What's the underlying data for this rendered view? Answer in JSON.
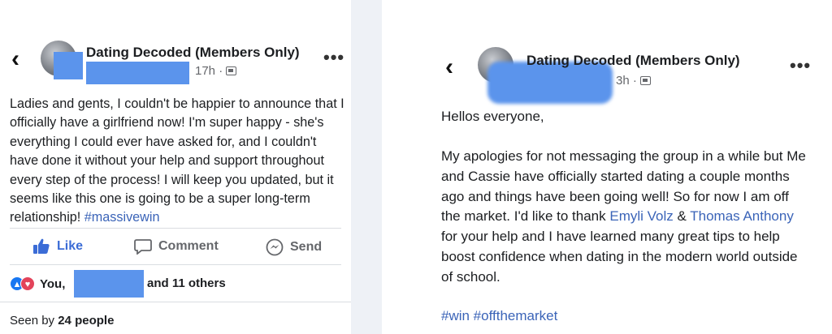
{
  "left_post": {
    "back_icon": "chevron-left-icon",
    "group_name": "Dating Decoded (Members Only)",
    "time": "17h ·",
    "privacy_icon": "members-icon",
    "more_icon": "more-horizontal-icon",
    "more_label": "•••",
    "body": "Ladies and gents, I couldn't be happier to announce that I officially have a girlfriend now! I'm super happy - she's everything I could ever have asked for, and I couldn't have done it without your help and support throughout every step of the process! I will keep you updated, but it seems like this one is going to be a super long-term relationship!",
    "hashtag": "#massivewin",
    "actions": {
      "like": "Like",
      "comment": "Comment",
      "send": "Send"
    },
    "reactions": {
      "you": "You,",
      "others": "and 11 others"
    },
    "seen_prefix": "Seen by",
    "seen_count": "24 people"
  },
  "right_post": {
    "back_icon": "chevron-left-icon",
    "group_name": "Dating Decoded (Members Only)",
    "time": "3h ·",
    "privacy_icon": "members-icon",
    "more_label": "•••",
    "greeting": "Hellos everyone,",
    "body_part1": "My apologies for not messaging the group in a while but Me and Cassie have officially started dating a couple months ago and things have been going well! So for now I am off the market. I'd like to thank ",
    "mention1": "Emyli Volz",
    "amp": " & ",
    "mention2": "Thomas Anthony",
    "body_part2": " for your help and I have learned many great tips to help boost confidence when dating in the modern world outside of school.",
    "hashtags": "#win #offthemarket"
  },
  "colors": {
    "link": "#3b64b8",
    "redaction": "#5b94ec",
    "like_blue": "#3b6cd6"
  }
}
